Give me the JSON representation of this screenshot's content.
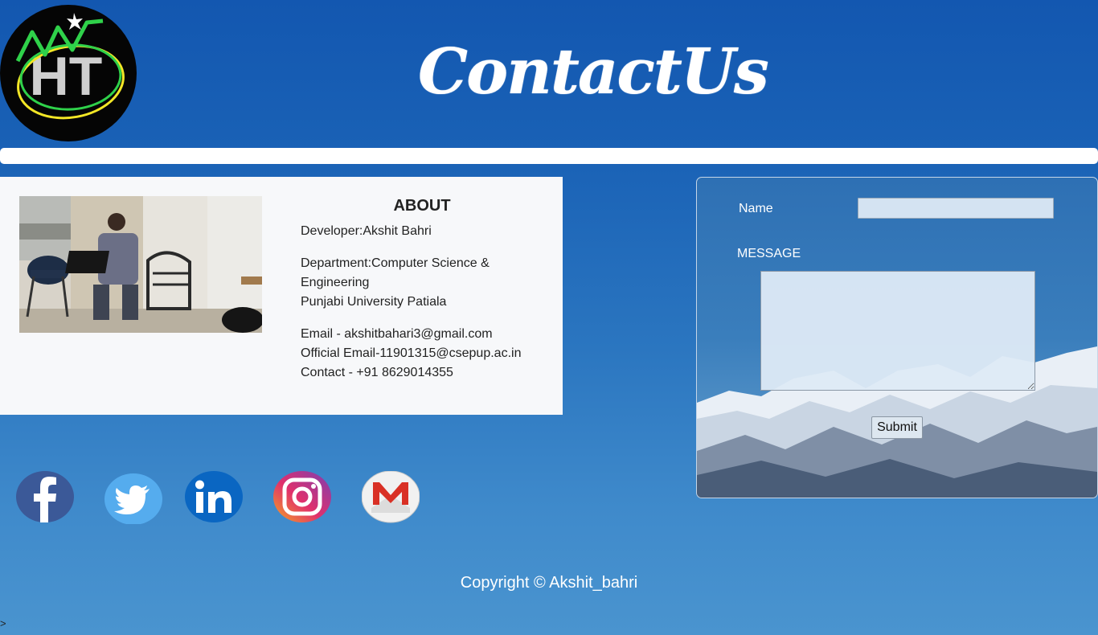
{
  "header": {
    "title": "ContactUs",
    "logo_text": "HT"
  },
  "about": {
    "heading": "ABOUT",
    "developer": "Developer:Akshit Bahri",
    "department_line1": "Department:Computer Science & Engineering",
    "department_line2": "Punjabi University Patiala",
    "email": "Email - akshitbahari3@gmail.com",
    "official_email": "Official Email-11901315@csepup.ac.in",
    "contact": "Contact - +91 8629014355"
  },
  "form": {
    "name_label": "Name",
    "message_label": "MESSAGE",
    "name_value": "",
    "message_value": "",
    "submit_label": "Submit"
  },
  "social": [
    {
      "name": "facebook-icon",
      "color": "#3b5998"
    },
    {
      "name": "twitter-icon",
      "color": "#55acee"
    },
    {
      "name": "linkedin-icon",
      "color": "#0a66c2"
    },
    {
      "name": "instagram-icon",
      "color": "#c13584"
    },
    {
      "name": "gmail-icon",
      "color": "#d93025"
    }
  ],
  "footer": {
    "copyright": "Copyright © Akshit_bahri"
  },
  "stray_text": ">"
}
